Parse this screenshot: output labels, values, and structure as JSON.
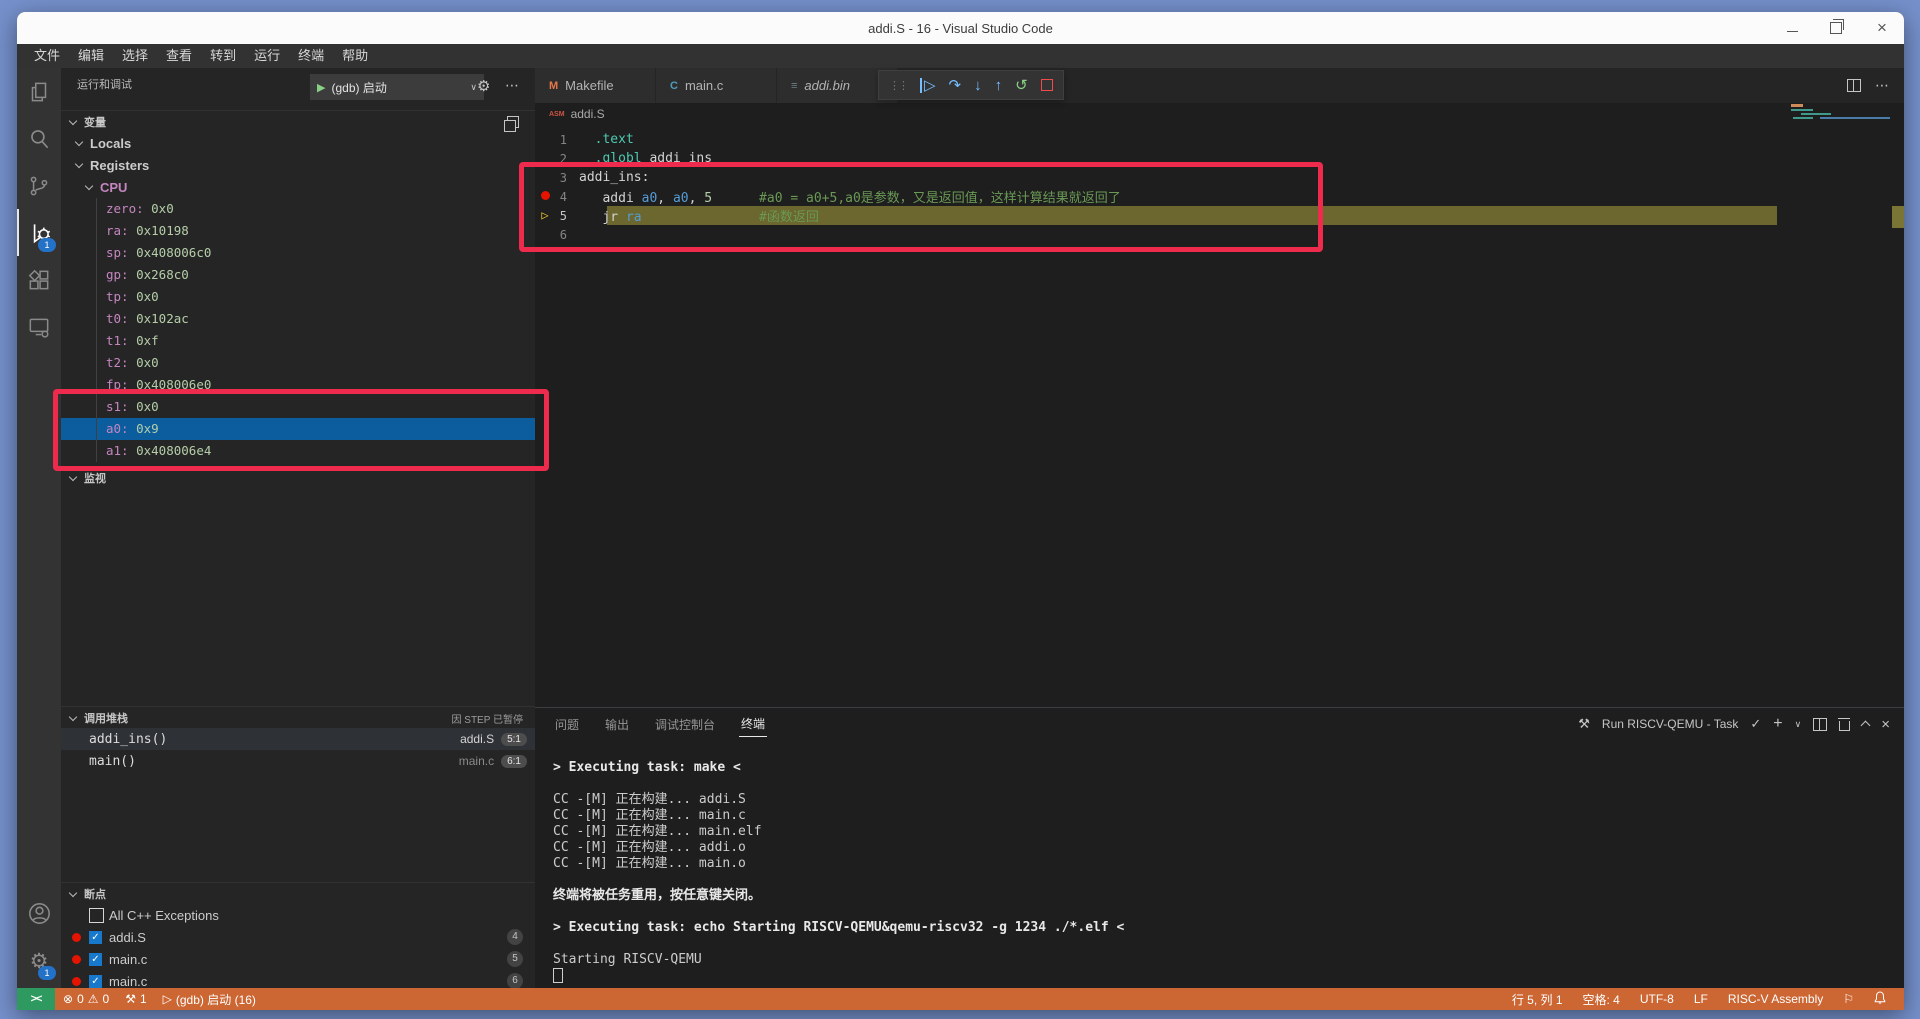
{
  "colors": {
    "statusbar": "#cc6633",
    "annotation_red": "#ee2b4d",
    "selection_blue": "#0b5d9e",
    "current_line_olive": "#6b672e",
    "badge_blue": "#2472c8",
    "breakpoint_red": "#e51400"
  },
  "window": {
    "title": "addi.S - 16 - Visual Studio Code",
    "menu": [
      "文件",
      "编辑",
      "选择",
      "查看",
      "转到",
      "运行",
      "终端",
      "帮助"
    ]
  },
  "activity_bar": {
    "debug_badge": "1",
    "settings_badge": "1"
  },
  "sidebar": {
    "header": {
      "title": "运行和调试",
      "config": "(gdb) 启动"
    },
    "variables_label": "变量",
    "locals_label": "Locals",
    "registers_label": "Registers",
    "cpu_label": "CPU",
    "registers": [
      {
        "name": "zero",
        "value": "0x0"
      },
      {
        "name": "ra",
        "value": "0x10198"
      },
      {
        "name": "sp",
        "value": "0x408006c0"
      },
      {
        "name": "gp",
        "value": "0x268c0"
      },
      {
        "name": "tp",
        "value": "0x0"
      },
      {
        "name": "t0",
        "value": "0x102ac"
      },
      {
        "name": "t1",
        "value": "0xf"
      },
      {
        "name": "t2",
        "value": "0x0"
      },
      {
        "name": "fp",
        "value": "0x408006e0"
      },
      {
        "name": "s1",
        "value": "0x0"
      },
      {
        "name": "a0",
        "value": "0x9",
        "selected": true
      },
      {
        "name": "a1",
        "value": "0x408006e4"
      }
    ],
    "watch_label": "监视",
    "call_stack": {
      "label": "调用堆栈",
      "status": "因 STEP 已暂停",
      "frames": [
        {
          "name": "addi_ins()",
          "file": "addi.S",
          "pos": "5:1",
          "current": true
        },
        {
          "name": "main()",
          "file": "main.c",
          "pos": "6:1"
        }
      ]
    },
    "breakpoints": {
      "label": "断点",
      "items": [
        {
          "label": "All C++ Exceptions",
          "checked": false,
          "dot": false,
          "badge": ""
        },
        {
          "label": "addi.S",
          "checked": true,
          "dot": true,
          "badge": "4"
        },
        {
          "label": "main.c",
          "checked": true,
          "dot": true,
          "badge": "5"
        },
        {
          "label": "main.c",
          "checked": true,
          "dot": true,
          "badge": "6"
        }
      ]
    }
  },
  "editor": {
    "tabs": [
      {
        "label": "Makefile",
        "icon": "M",
        "color": "#e8774a",
        "italic": false
      },
      {
        "label": "main.c",
        "icon": "C",
        "color": "#519aba",
        "italic": false
      },
      {
        "label": "addi.bin",
        "icon": "≡",
        "color": "#6d8086",
        "italic": true
      }
    ],
    "breadcrumb_icon": "ASM",
    "breadcrumb": "addi.S",
    "code_lines": [
      {
        "num": "1",
        "gutter": "",
        "highlight": false,
        "tokens": [
          [
            "  ",
            "pl"
          ],
          [
            ".text",
            "dir"
          ]
        ]
      },
      {
        "num": "2",
        "gutter": "",
        "highlight": false,
        "tokens": [
          [
            "  ",
            "pl"
          ],
          [
            ".globl",
            "dir"
          ],
          [
            " addi_ins",
            "pl"
          ]
        ]
      },
      {
        "num": "3",
        "gutter": "",
        "highlight": false,
        "tokens": [
          [
            "addi_ins:",
            "pl"
          ]
        ]
      },
      {
        "num": "4",
        "gutter": "breakpoint",
        "highlight": false,
        "tokens": [
          [
            "   ",
            "pl"
          ],
          [
            "addi ",
            "pl"
          ],
          [
            "a0",
            "reg"
          ],
          [
            ", ",
            "pl"
          ],
          [
            "a0",
            "reg"
          ],
          [
            ", ",
            "pl"
          ],
          [
            "5",
            "num"
          ],
          [
            "      ",
            "pl"
          ],
          [
            "#a0 = a0+5,a0是参数，又是返回值，这样计算结果就返回了",
            "com"
          ]
        ]
      },
      {
        "num": "5",
        "gutter": "arrow",
        "highlight": true,
        "tokens": [
          [
            "   ",
            "pl"
          ],
          [
            "jr ",
            "pl"
          ],
          [
            "ra",
            "reg"
          ],
          [
            "               ",
            "pl"
          ],
          [
            "#函数返回",
            "com"
          ]
        ]
      },
      {
        "num": "6",
        "gutter": "",
        "highlight": false,
        "tokens": []
      }
    ]
  },
  "panel": {
    "tabs": [
      {
        "label": "问题",
        "active": false
      },
      {
        "label": "输出",
        "active": false
      },
      {
        "label": "调试控制台",
        "active": false
      },
      {
        "label": "终端",
        "active": true
      }
    ],
    "toolbar_label": "Run RISCV-QEMU - Task",
    "terminal_lines": [
      {
        "t": "> Executing task: make <",
        "b": true
      },
      {
        "t": "",
        "b": false
      },
      {
        "t": "CC -[M] 正在构建... addi.S",
        "b": false
      },
      {
        "t": "CC -[M] 正在构建... main.c",
        "b": false
      },
      {
        "t": "CC -[M] 正在构建... main.elf",
        "b": false
      },
      {
        "t": "CC -[M] 正在构建... addi.o",
        "b": false
      },
      {
        "t": "CC -[M] 正在构建... main.o",
        "b": false
      },
      {
        "t": "",
        "b": false
      },
      {
        "t": "终端将被任务重用，按任意键关闭。",
        "b": true
      },
      {
        "t": "",
        "b": false
      },
      {
        "t": "> Executing task: echo Starting RISCV-QEMU&qemu-riscv32 -g 1234 ./*.elf <",
        "b": true
      },
      {
        "t": "",
        "b": false
      },
      {
        "t": "Starting RISCV-QEMU",
        "b": false
      },
      {
        "t": "",
        "b": false,
        "cursor": true
      }
    ]
  },
  "status": {
    "remote": "><",
    "errors": "0",
    "warnings": "0",
    "tasks": "1",
    "debug_label": "(gdb) 启动 (16)",
    "line_col": "行 5, 列 1",
    "indent": "空格: 4",
    "encoding": "UTF-8",
    "eol": "LF",
    "language": "RISC-V Assembly"
  }
}
